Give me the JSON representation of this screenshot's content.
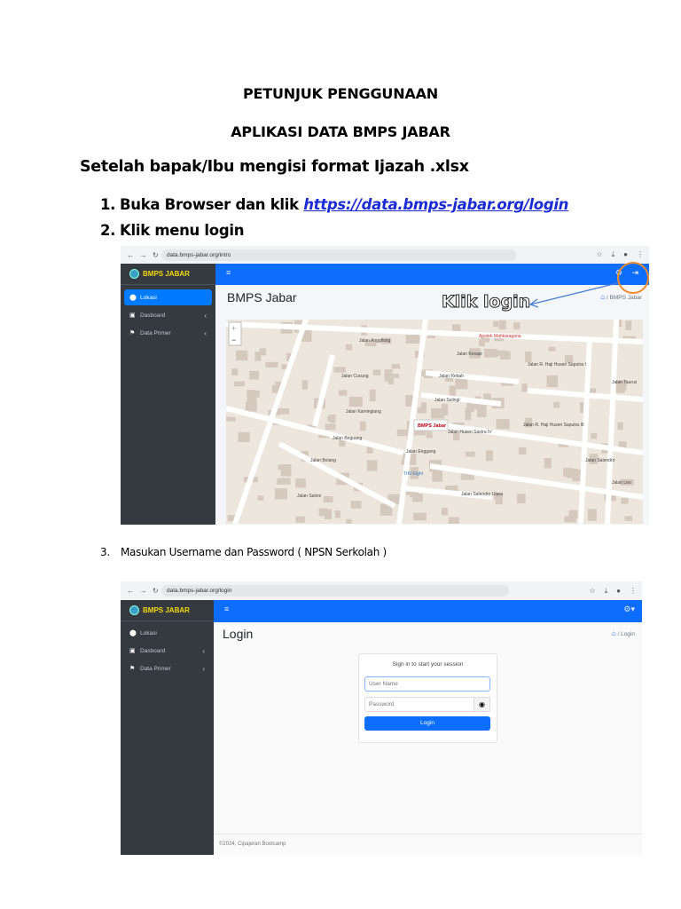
{
  "document": {
    "title": "PETUNJUK PENGGUNAAN",
    "subtitle": "APLIKASI DATA BMPS JABAR",
    "intro": "Setelah bapak/Ibu mengisi format Ijazah .xlsx",
    "steps": [
      {
        "num": "1.",
        "text": "Buka Browser dan klik ",
        "link": "https://data.bmps-jabar.org/login"
      },
      {
        "num": "2.",
        "text": "Klik menu login"
      },
      {
        "num": "3.",
        "text": "Masukan Username dan Password ( NPSN Serkolah )"
      }
    ]
  },
  "screenshot1": {
    "url": "data.bmps-jabar.org/intro",
    "brand": "BMPS JABAR",
    "sidebar": [
      "Lokasi",
      "Dasboard",
      "Data Primer"
    ],
    "page_title": "BMPS Jabar",
    "breadcrumb": "/ BMPS Jabar",
    "annotation": "Klik login",
    "map_marker": "BMPS Jabar",
    "map_labels": [
      "Jalan Anggilang",
      "Jalan Kesapi",
      "Jalan Cucung",
      "Jalan Rebah",
      "Jalan Sulingi",
      "Jalan Kaminglang",
      "Jalan Beguang",
      "Jalan Bolang",
      "Jalan Salendro Utara",
      "Jalan R. Haji Husen Saputra I",
      "Jalan R. Haji Husen Saputra III",
      "Jalan Husen Sastra IV",
      "Jalan Leo",
      "Jalan Taurus",
      "Jalan Salendro",
      "Jalan Saloni",
      "Jalan Enggang",
      "Apotek Mahkaragana",
      "TIKI Eight"
    ],
    "zoom_in": "+",
    "zoom_out": "−"
  },
  "screenshot2": {
    "url": "data.bmps-jabar.org/login",
    "brand": "BMPS JABAR",
    "sidebar": [
      "Lokasi",
      "Dasboard",
      "Data Primer"
    ],
    "page_title": "Login",
    "breadcrumb": "/ Login",
    "login_box": {
      "heading": "Sign in to start your session",
      "username_placeholder": "User Name",
      "password_placeholder": "Password",
      "button": "Login"
    },
    "footer": "©2024, Cipajeran Bootcamp"
  },
  "colors": {
    "primary": "#0d6efd",
    "sidebar": "#343a40",
    "link": "#1a2bd6",
    "highlight": "#f08a2c",
    "brand": "#f5d90a"
  }
}
